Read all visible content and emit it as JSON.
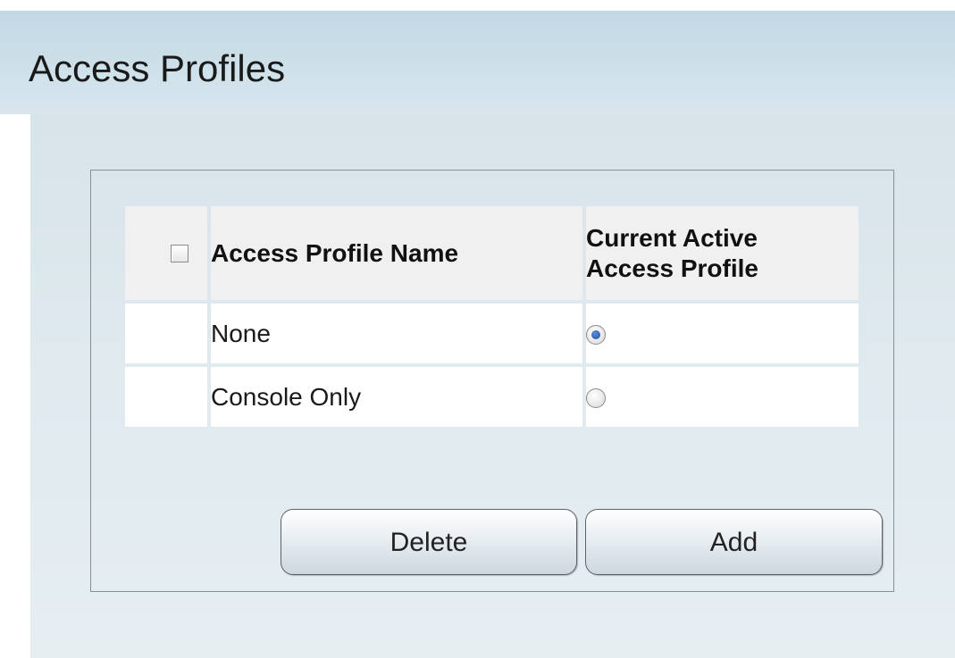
{
  "page": {
    "title": "Access Profiles"
  },
  "table": {
    "headers": {
      "select_all": "",
      "name": "Access Profile Name",
      "active_line1": "Current Active",
      "active_line2": "Access Profile"
    },
    "rows": [
      {
        "name": "None",
        "active": true
      },
      {
        "name": "Console Only",
        "active": false
      }
    ]
  },
  "buttons": {
    "delete": "Delete",
    "add": "Add"
  },
  "colors": {
    "radio_selected": "#1f4f9e",
    "header_bg": "#c2d8e4"
  }
}
